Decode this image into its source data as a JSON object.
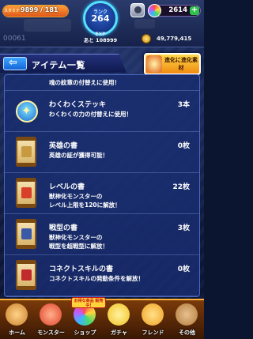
{
  "status": {
    "stamina_label": "スタミナ",
    "stamina_value": "9899",
    "stamina_max": "181",
    "stamina_fill_fraction": 1.0,
    "user_id": "00061",
    "rank_label": "ランク",
    "rank_value": "264",
    "exp_label": "EXP",
    "exp_remaining": "あと 108999",
    "orbs": "2614",
    "orb_plus": "+",
    "gold": "49,779,415"
  },
  "header": {
    "back_symbol": "⇦",
    "title": "アイテム一覧",
    "evolve_banner": "進化に進化素材"
  },
  "items": {
    "partial": {
      "desc": "魂の紋章の付替えに使用！"
    },
    "list": [
      {
        "name": "わくわくステッキ",
        "count": "3本",
        "desc": "わくわくの力の付替えに使用！",
        "icon": "magic-stick-icon"
      },
      {
        "name": "英雄の書",
        "count": "0枚",
        "desc": "英雄の証が獲得可能！",
        "icon": "hero-book-icon"
      },
      {
        "name": "レベルの書",
        "count": "22枚",
        "desc": "獣神化モンスターの\nレベル上限を120に解放！",
        "icon": "level-book-icon"
      },
      {
        "name": "戦型の書",
        "count": "3枚",
        "desc": "獣神化モンスターの\n戦型を超戦型に解放！",
        "icon": "battle-type-book-icon"
      },
      {
        "name": "コネクトスキルの書",
        "count": "0枚",
        "desc": "コネクトスキルの発動条件を解放！",
        "icon": "connect-skill-book-icon"
      }
    ]
  },
  "nav": {
    "sale_badge": "お得な商品 販売中!",
    "items": [
      {
        "label": "ホーム",
        "icon": "home-icon",
        "color": "#c9802a"
      },
      {
        "label": "モンスター",
        "icon": "monster-icon",
        "color": "#e0402a"
      },
      {
        "label": "ショップ",
        "icon": "shop-icon",
        "color": "#6ad0ff"
      },
      {
        "label": "ガチャ",
        "icon": "gacha-icon",
        "color": "#f0c020"
      },
      {
        "label": "フレンド",
        "icon": "friend-icon",
        "color": "#f0a020"
      },
      {
        "label": "その他",
        "icon": "other-icon",
        "color": "#b07a3a"
      }
    ]
  },
  "colors": {
    "panel": "#1e3272",
    "accent": "#ffb23a",
    "level_book_emblem": "#d8402a",
    "hero_book_emblem": "#c89a40",
    "battle_book_emblem": "#3a5aa8",
    "connect_book_emblem": "#c02a2a"
  }
}
